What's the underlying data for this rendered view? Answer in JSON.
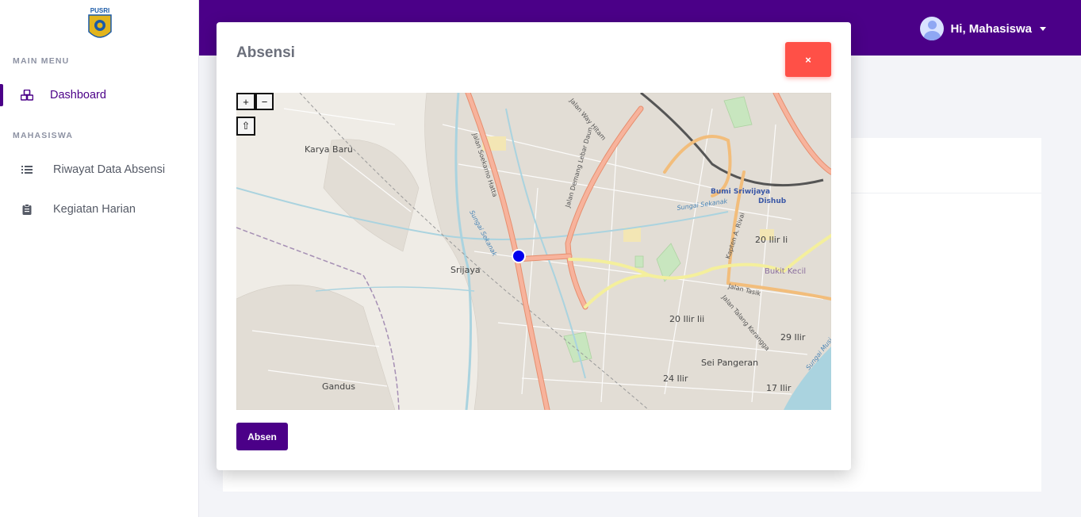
{
  "sidebar": {
    "logo_text": "PUSRI",
    "main_menu_title": "MAIN MENU",
    "items_main": [
      {
        "label": "Dashboard",
        "icon": "cubes-icon",
        "active": true
      }
    ],
    "mahasiswa_title": "MAHASISWA",
    "items_mahasiswa": [
      {
        "label": "Riwayat Data Absensi",
        "icon": "list-icon"
      },
      {
        "label": "Kegiatan Harian",
        "icon": "clipboard-icon"
      }
    ]
  },
  "topbar": {
    "user_greeting": "Hi, Mahasiswa"
  },
  "modal": {
    "title": "Absensi",
    "close_label": "×",
    "submit_label": "Absen"
  },
  "map": {
    "zoom_in": "+",
    "zoom_out": "−",
    "locate": "⇧",
    "place_labels": [
      "Karya Baru",
      "Srijaya",
      "Gandus",
      "Bumi Sriwijaya",
      "Dishub",
      "20 Ilir Ii",
      "20 Ilir Iii",
      "Bukit Kecil",
      "Sei Pangeran",
      "24 Ilir",
      "17 Ilir",
      "29 Ilir"
    ],
    "road_labels": [
      "Jalan Soekarno Hatta",
      "Jalan Demang Lebar Daun",
      "Jalan Way Hitam",
      "Jalan Tasik",
      "Kapten A. Rivai",
      "Jalan Talang Kerangga",
      "Sungai Sekanak",
      "Sungai Sekanak",
      "Sungai Musi"
    ],
    "marker_color": "#0000ee"
  },
  "colors": {
    "brand": "#4b0088",
    "danger": "#ff5047"
  }
}
